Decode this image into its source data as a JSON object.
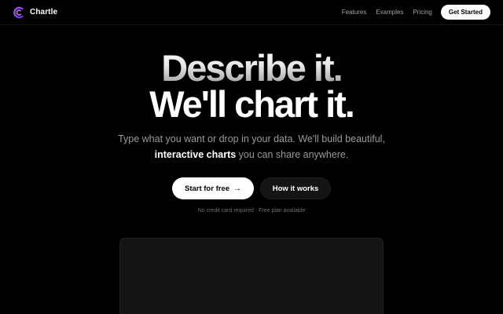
{
  "nav": {
    "brand": "Chartle",
    "links": [
      "Features",
      "Examples",
      "Pricing"
    ],
    "cta": "Get Started"
  },
  "hero": {
    "title_line1": "Describe it.",
    "title_line2": "We'll chart it.",
    "subtitle_line1": "Type what you want or drop in your data. We'll build beautiful,",
    "subtitle_strong": "interactive charts",
    "subtitle_rest": " you can share anywhere.",
    "primary_button": "Start for free",
    "primary_arrow": "→",
    "secondary_button": "How it works",
    "note": "No credit card required · Free plan available"
  },
  "colors": {
    "background": "#000000",
    "accent_logo": "#7c3aed",
    "muted_text": "#9a9a9a"
  }
}
